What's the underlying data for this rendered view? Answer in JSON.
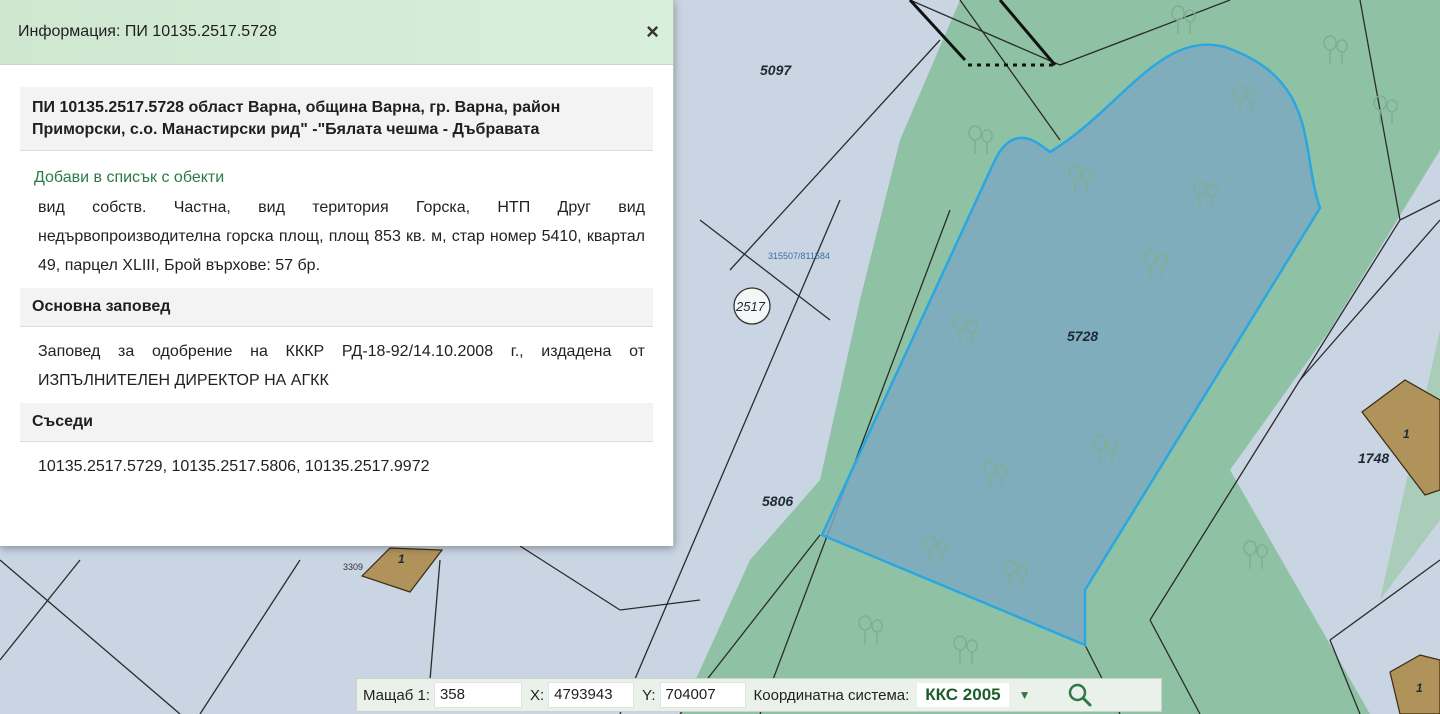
{
  "panel": {
    "title": "Информация: ПИ 10135.2517.5728",
    "close_label": "×",
    "property_heading": "ПИ 10135.2517.5728 област Варна, община Варна, гр. Варна, район Приморски, с.о. Манастирски рид\" -\"Бялата чешма - Дъбравата",
    "add_link": "Добави в списък с обекти",
    "description": "вид собств. Частна, вид територия Горска, НТП Друг вид недървопроизводителна горска площ, площ 853 кв. м, стар номер 5410, квартал 49, парцел XLIII, Брой върхове: 57 бр.",
    "order_heading": "Основна заповед",
    "order_text": "Заповед за одобрение на КККР РД-18-92/14.10.2008 г., издадена от ИЗПЪЛНИТЕЛЕН ДИРЕКТОР НА АГКК",
    "neighbors_heading": "Съседи",
    "neighbors_text": "10135.2517.5729, 10135.2517.5806, 10135.2517.9972"
  },
  "map": {
    "labels": {
      "p5097": "5097",
      "p5728": "5728",
      "p5806": "5806",
      "p1748": "1748",
      "circle_2517": "2517",
      "coords": "315507/811584",
      "small_3309": "3309",
      "bld_1a": "1",
      "bld_1b": "1",
      "bld_1c": "1"
    },
    "colors": {
      "background": "#c9d5e3",
      "forest": "#8fc2a5",
      "parcel_fill": "#7ea9bf",
      "parcel_outline": "#2aa7e0",
      "building": "#b0935a"
    }
  },
  "bottom_bar": {
    "scale_label": "Мащаб 1:",
    "scale_value": "358",
    "x_label": "X:",
    "x_value": "4793943",
    "y_label": "Y:",
    "y_value": "704007",
    "crs_label": "Координатна система:",
    "crs_value": "ККС 2005",
    "dropdown_arrow": "▼",
    "search_icon": "search-icon"
  }
}
